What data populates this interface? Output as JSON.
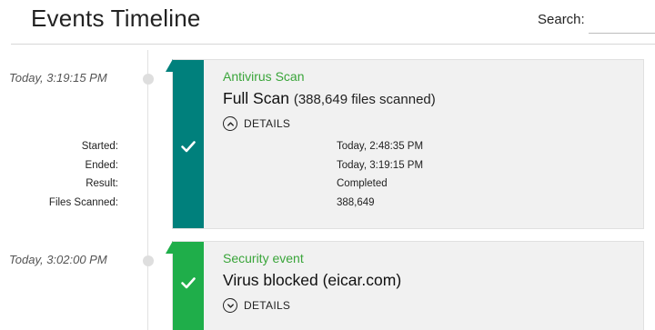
{
  "header": {
    "title": "Events Timeline",
    "search_label": "Search:",
    "search_value": "",
    "search_placeholder": ""
  },
  "colors": {
    "scan_accent": "#00807c",
    "security_accent": "#1fae4a",
    "category_text": "#3aa53a",
    "card_background": "#f1f1f1"
  },
  "events": [
    {
      "timestamp": "Today, 3:19:15 PM",
      "category": "Antivirus Scan",
      "title": "Full Scan",
      "title_detail": "(388,649 files scanned)",
      "status_icon": "check-icon",
      "details_label": "DETAILS",
      "details_expanded": true,
      "details_icon": "chevron-up-circle-icon",
      "details": [
        {
          "key": "Started:",
          "value": "Today, 2:48:35 PM"
        },
        {
          "key": "Ended:",
          "value": "Today, 3:19:15 PM"
        },
        {
          "key": "Result:",
          "value": "Completed"
        },
        {
          "key": "Files Scanned:",
          "value": "388,649"
        }
      ]
    },
    {
      "timestamp": "Today, 3:02:00 PM",
      "category": "Security event",
      "title": "Virus blocked (eicar.com)",
      "status_icon": "check-icon",
      "details_label": "DETAILS",
      "details_expanded": false,
      "details_icon": "chevron-down-circle-icon"
    }
  ]
}
